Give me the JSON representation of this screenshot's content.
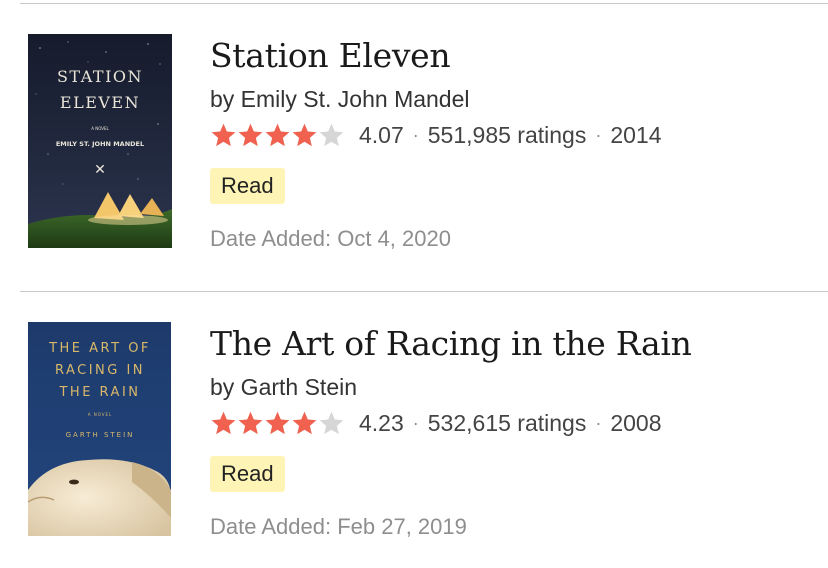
{
  "books": [
    {
      "title": "Station Eleven",
      "author": "by Emily St. John Mandel",
      "rating": 4.07,
      "rating_text": "4.07",
      "ratings_count": "551,985 ratings",
      "year": "2014",
      "status": "Read",
      "date_added": "Date Added: Oct 4, 2020",
      "cover": {
        "title_line1": "STATION",
        "title_line2": "ELEVEN",
        "subtitle": "A NOVEL",
        "author": "EMILY ST. JOHN MANDEL",
        "bg_color": "#1c2233",
        "text_color": "#e8e4d8"
      }
    },
    {
      "title": "The Art of Racing in the Rain",
      "author": "by Garth Stein",
      "rating": 4.23,
      "rating_text": "4.23",
      "ratings_count": "532,615 ratings",
      "year": "2008",
      "status": "Read",
      "date_added": "Date Added: Feb 27, 2019",
      "cover": {
        "title_line1": "THE ART OF",
        "title_line2": "RACING IN",
        "title_line3": "THE RAIN",
        "subtitle": "A NOVEL",
        "author": "GARTH STEIN",
        "bg_color": "#1d3a6b",
        "text_color": "#d9b86a"
      }
    }
  ],
  "colors": {
    "star_filled": "#f0624f",
    "star_empty": "#d6d6d6",
    "badge_bg": "#fdf4b5",
    "divider": "#c8c8c8"
  },
  "separator": "·"
}
